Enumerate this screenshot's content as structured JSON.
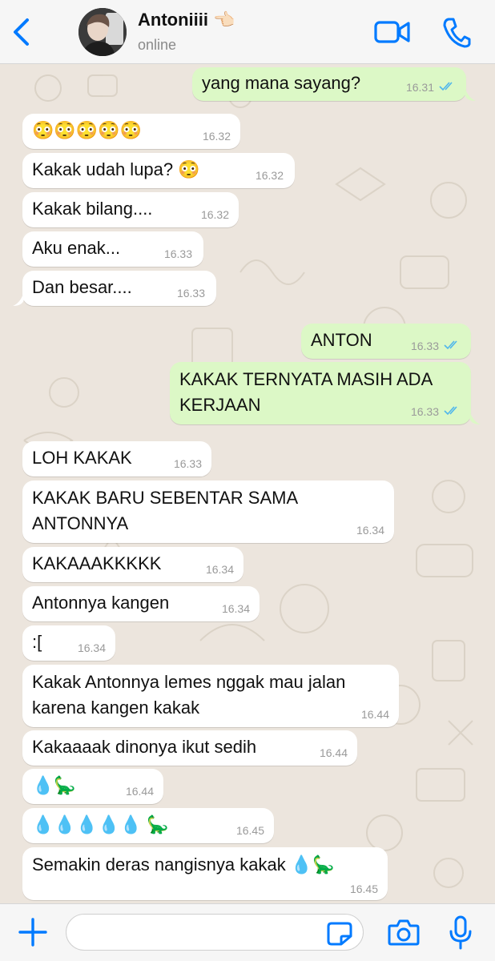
{
  "header": {
    "back_icon": "chevron-left-icon",
    "contact_name": "Antoniiii 👈🏻",
    "status": "online",
    "video_icon": "video-camera-icon",
    "call_icon": "phone-icon"
  },
  "colors": {
    "accent": "#007aff",
    "outgoing_bubble": "#dcf8c6",
    "incoming_bubble": "#ffffff",
    "read_ticks": "#4fb6ec"
  },
  "messages": [
    {
      "dir": "out",
      "text": "yang mana sayang?",
      "time": "16.31",
      "read": true
    },
    {
      "dir": "in",
      "text": "😳😳😳😳😳",
      "time": "16.32"
    },
    {
      "dir": "in",
      "text": "Kakak udah lupa? 😳",
      "time": "16.32"
    },
    {
      "dir": "in",
      "text": "Kakak bilang....",
      "time": "16.32"
    },
    {
      "dir": "in",
      "text": "Aku enak...",
      "time": "16.33"
    },
    {
      "dir": "in",
      "text": "Dan besar....",
      "time": "16.33"
    },
    {
      "dir": "out",
      "text": "ANTON",
      "time": "16.33",
      "read": true
    },
    {
      "dir": "out",
      "line1": "KAKAK TERNYATA MASIH ADA",
      "line2": "KERJAAN",
      "time": "16.33",
      "read": true
    },
    {
      "dir": "in",
      "text": "LOH KAKAK",
      "time": "16.33"
    },
    {
      "dir": "in",
      "line1": "KAKAK BARU SEBENTAR SAMA",
      "line2": "ANTONNYA",
      "time": "16.34"
    },
    {
      "dir": "in",
      "text": "KAKAAAKKKKK",
      "time": "16.34"
    },
    {
      "dir": "in",
      "text": "Antonnya kangen",
      "time": "16.34"
    },
    {
      "dir": "in",
      "text": ":[",
      "time": "16.34"
    },
    {
      "dir": "in",
      "line1": "Kakak Antonnya lemes nggak mau jalan",
      "line2": "karena kangen kakak",
      "time": "16.44"
    },
    {
      "dir": "in",
      "text": "Kakaaaak dinonya ikut sedih",
      "time": "16.44"
    },
    {
      "dir": "in",
      "text": "💧🦕",
      "time": "16.44"
    },
    {
      "dir": "in",
      "text": "💧💧💧💧💧 🦕",
      "time": "16.45"
    },
    {
      "dir": "in",
      "text": "Semakin deras nangisnya kakak 💧🦕",
      "time": "16.45"
    }
  ],
  "input": {
    "plus_icon": "plus-icon",
    "placeholder": "",
    "sticker_icon": "sticker-icon",
    "camera_icon": "camera-icon",
    "mic_icon": "microphone-icon"
  }
}
